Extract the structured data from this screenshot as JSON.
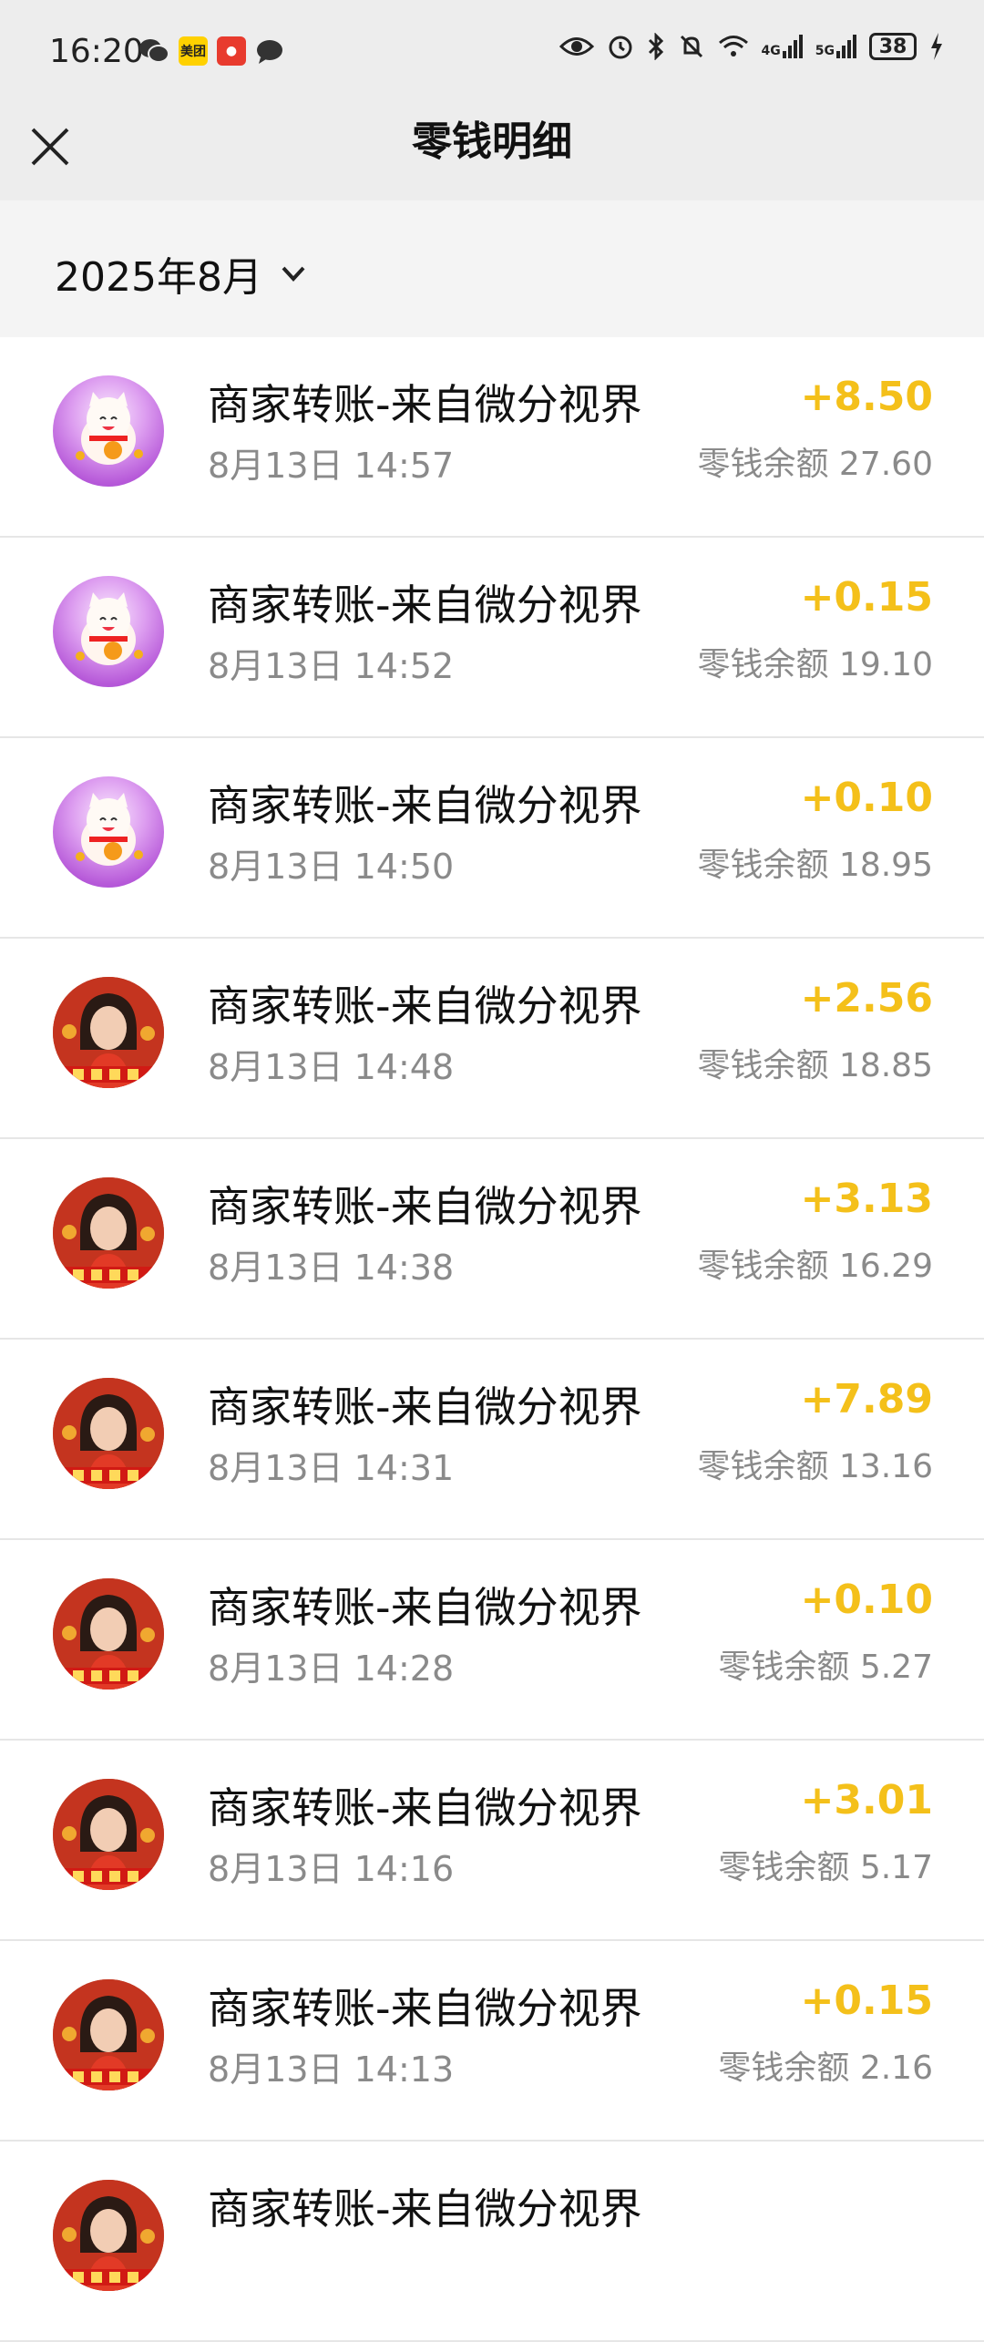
{
  "status_bar": {
    "time": "16:20",
    "left_icons": [
      "wechat-icon",
      "meituan-icon",
      "app-icon",
      "message-icon"
    ],
    "meituan_label": "美团",
    "right_icons": [
      "eye-icon",
      "alarm-icon",
      "bluetooth-icon",
      "mute-icon",
      "wifi-icon",
      "signal-4g-icon",
      "signal-5g-icon"
    ],
    "battery": "38",
    "network1": "4G",
    "network2": "5G"
  },
  "header": {
    "title": "零钱明细"
  },
  "filter": {
    "month": "2025年8月"
  },
  "transactions": [
    {
      "title": "商家转账-来自微分视界",
      "time": "8月13日 14:57",
      "amount": "+8.50",
      "balance": "零钱余额 27.60",
      "avatar": "cat"
    },
    {
      "title": "商家转账-来自微分视界",
      "time": "8月13日 14:52",
      "amount": "+0.15",
      "balance": "零钱余额 19.10",
      "avatar": "cat"
    },
    {
      "title": "商家转账-来自微分视界",
      "time": "8月13日 14:50",
      "amount": "+0.10",
      "balance": "零钱余额 18.95",
      "avatar": "cat"
    },
    {
      "title": "商家转账-来自微分视界",
      "time": "8月13日 14:48",
      "amount": "+2.56",
      "balance": "零钱余额 18.85",
      "avatar": "girl"
    },
    {
      "title": "商家转账-来自微分视界",
      "time": "8月13日 14:38",
      "amount": "+3.13",
      "balance": "零钱余额 16.29",
      "avatar": "girl"
    },
    {
      "title": "商家转账-来自微分视界",
      "time": "8月13日 14:31",
      "amount": "+7.89",
      "balance": "零钱余额 13.16",
      "avatar": "girl"
    },
    {
      "title": "商家转账-来自微分视界",
      "time": "8月13日 14:28",
      "amount": "+0.10",
      "balance": "零钱余额 5.27",
      "avatar": "girl"
    },
    {
      "title": "商家转账-来自微分视界",
      "time": "8月13日 14:16",
      "amount": "+3.01",
      "balance": "零钱余额 5.17",
      "avatar": "girl"
    },
    {
      "title": "商家转账-来自微分视界",
      "time": "8月13日 14:13",
      "amount": "+0.15",
      "balance": "零钱余额 2.16",
      "avatar": "girl"
    },
    {
      "title": "商家转账-来自微分视界",
      "time": "",
      "amount": "",
      "balance": "",
      "avatar": "girl"
    }
  ],
  "colors": {
    "amount": "#f4c01a",
    "header_bg": "#ededed"
  }
}
